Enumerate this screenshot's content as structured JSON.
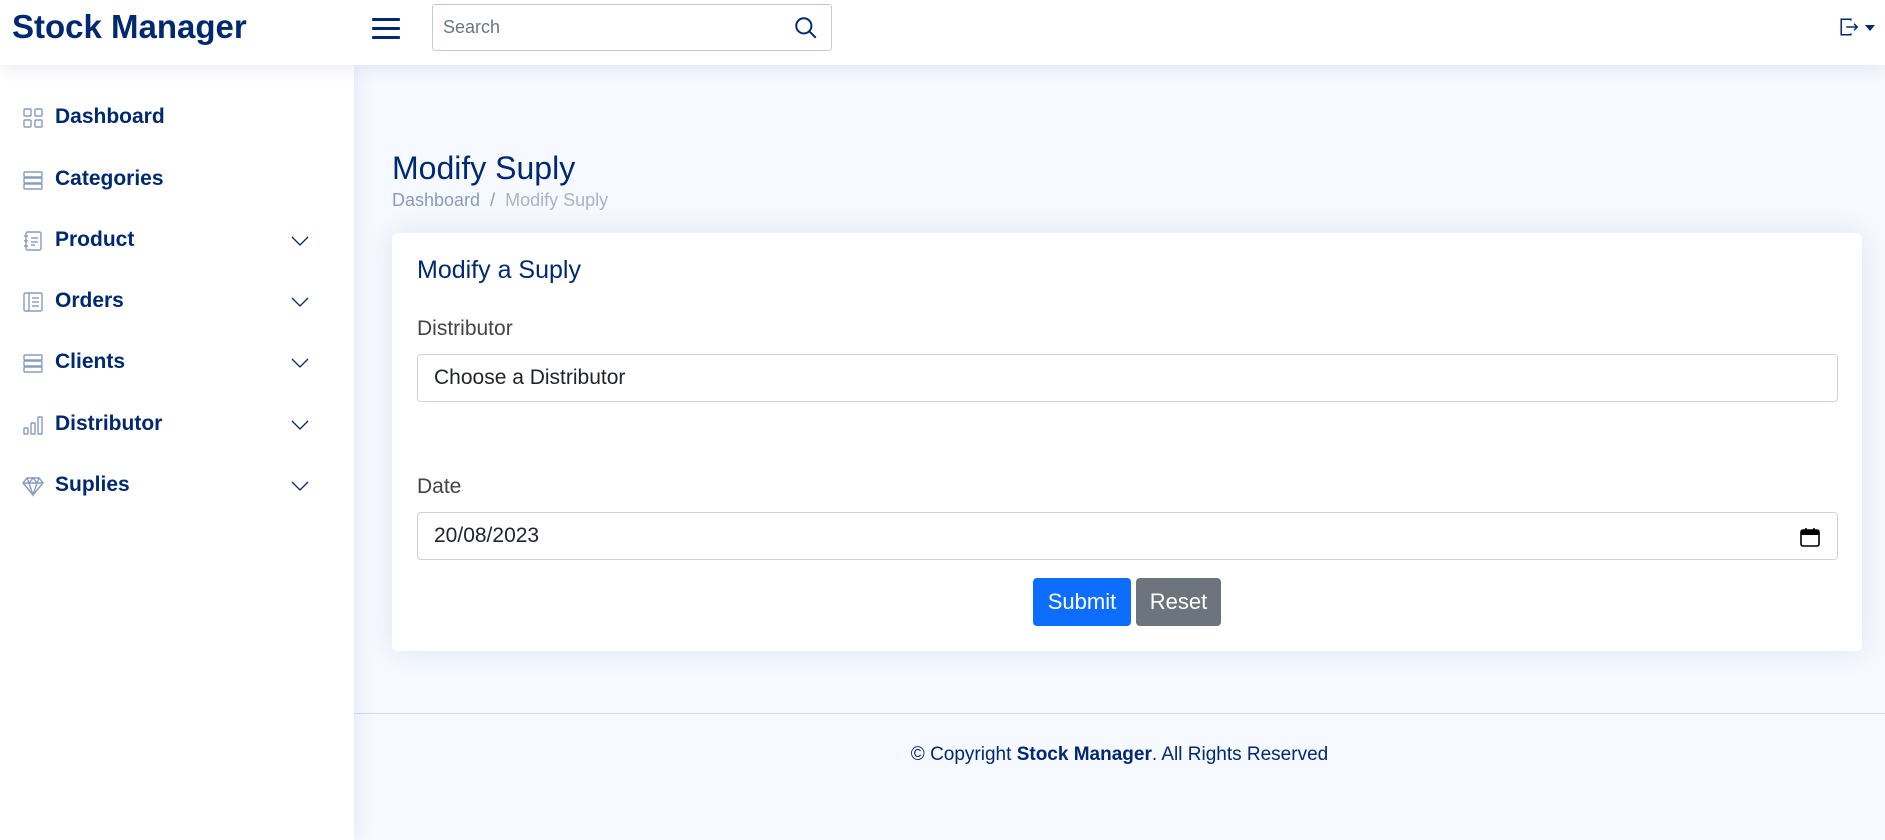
{
  "header": {
    "logo_text": "Stock Manager",
    "menu_icon": "hamburger-menu-icon",
    "search": {
      "placeholder": "Search",
      "value": "",
      "icon": "search-icon"
    },
    "account_icon": "logout-icon",
    "account_caret_icon": "caret-down-icon"
  },
  "sidebar": {
    "items": [
      {
        "label": "Dashboard",
        "icon": "grid-icon",
        "expandable": false
      },
      {
        "label": "Categories",
        "icon": "server-icon",
        "expandable": false
      },
      {
        "label": "Product",
        "icon": "journal-text-icon",
        "expandable": true
      },
      {
        "label": "Orders",
        "icon": "layout-text-icon",
        "expandable": true
      },
      {
        "label": "Clients",
        "icon": "server-icon",
        "expandable": true
      },
      {
        "label": "Distributor",
        "icon": "bar-chart-icon",
        "expandable": true
      },
      {
        "label": "Suplies",
        "icon": "gem-icon",
        "expandable": true
      }
    ]
  },
  "page": {
    "title": "Modify Suply",
    "breadcrumb": {
      "home": "Dashboard",
      "separator": "/",
      "current": "Modify Suply"
    }
  },
  "form": {
    "title": "Modify a Suply",
    "distributor": {
      "label": "Distributor",
      "selected": "Choose a Distributor"
    },
    "date": {
      "label": "Date",
      "value": "20/08/2023",
      "icon": "calendar-icon"
    },
    "submit_label": "Submit",
    "reset_label": "Reset"
  },
  "footer": {
    "prefix": "© Copyright",
    "brand": "Stock Manager",
    "suffix": ". All Rights Reserved"
  },
  "colors": {
    "brand": "#012970",
    "background": "#f6f9ff",
    "primary_button": "#0d6efd",
    "secondary_button": "#6c757d",
    "muted_text": "#899bbd"
  }
}
